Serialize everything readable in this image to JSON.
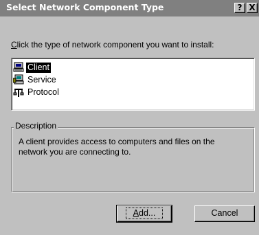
{
  "window": {
    "title": "Select Network Component Type",
    "help_glyph": "?",
    "close_glyph": "X"
  },
  "prompt": {
    "mnemonic": "C",
    "rest": "lick the type of network component you want to install:"
  },
  "components": [
    {
      "label": "Client",
      "icon": "client-computer-icon",
      "selected": true
    },
    {
      "label": "Service",
      "icon": "service-computer-icon",
      "selected": false
    },
    {
      "label": "Protocol",
      "icon": "protocol-network-icon",
      "selected": false
    }
  ],
  "description": {
    "legend": "Description",
    "text": "A client provides access to computers and files on the network you are connecting to."
  },
  "buttons": {
    "add_mnemonic": "A",
    "add_rest": "dd...",
    "cancel": "Cancel"
  },
  "colors": {
    "face": "#c0c0c0",
    "titlebar": "#808080",
    "selection": "#000000"
  }
}
